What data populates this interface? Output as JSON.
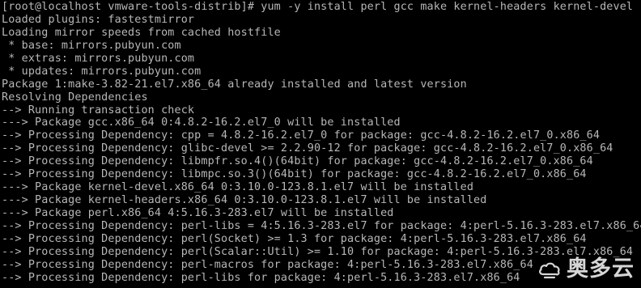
{
  "terminal": {
    "lines": [
      "[root@localhost vmware-tools-distrib]# yum -y install perl gcc make kernel-headers kernel-devel",
      "Loaded plugins: fastestmirror",
      "Loading mirror speeds from cached hostfile",
      " * base: mirrors.pubyun.com",
      " * extras: mirrors.pubyun.com",
      " * updates: mirrors.pubyun.com",
      "Package 1:make-3.82-21.el7.x86_64 already installed and latest version",
      "Resolving Dependencies",
      "--> Running transaction check",
      "---> Package gcc.x86_64 0:4.8.2-16.2.el7_0 will be installed",
      "--> Processing Dependency: cpp = 4.8.2-16.2.el7_0 for package: gcc-4.8.2-16.2.el7_0.x86_64",
      "--> Processing Dependency: glibc-devel >= 2.2.90-12 for package: gcc-4.8.2-16.2.el7_0.x86_64",
      "--> Processing Dependency: libmpfr.so.4()(64bit) for package: gcc-4.8.2-16.2.el7_0.x86_64",
      "--> Processing Dependency: libmpc.so.3()(64bit) for package: gcc-4.8.2-16.2.el7_0.x86_64",
      "---> Package kernel-devel.x86_64 0:3.10.0-123.8.1.el7 will be installed",
      "---> Package kernel-headers.x86_64 0:3.10.0-123.8.1.el7 will be installed",
      "---> Package perl.x86_64 4:5.16.3-283.el7 will be installed",
      "--> Processing Dependency: perl-libs = 4:5.16.3-283.el7 for package: 4:perl-5.16.3-283.el7.x86_64",
      "--> Processing Dependency: perl(Socket) >= 1.3 for package: 4:perl-5.16.3-283.el7.x86_64",
      "--> Processing Dependency: perl(Scalar::Util) >= 1.10 for package: 4:perl-5.16.3-283.el7.x86_64",
      "--> Processing Dependency: perl-macros for package: 4:perl-5.16.3-283.el7.x86_64",
      "--> Processing Dependency: perl-libs for package: 4:perl-5.16.3-283.el7.x86_64"
    ]
  },
  "watermark": {
    "text": "奥多云",
    "icon": "cloud-logo-icon"
  },
  "colors": {
    "background": "#000000",
    "foreground": "#b7b7b7",
    "watermark": "#e9e9e9"
  }
}
